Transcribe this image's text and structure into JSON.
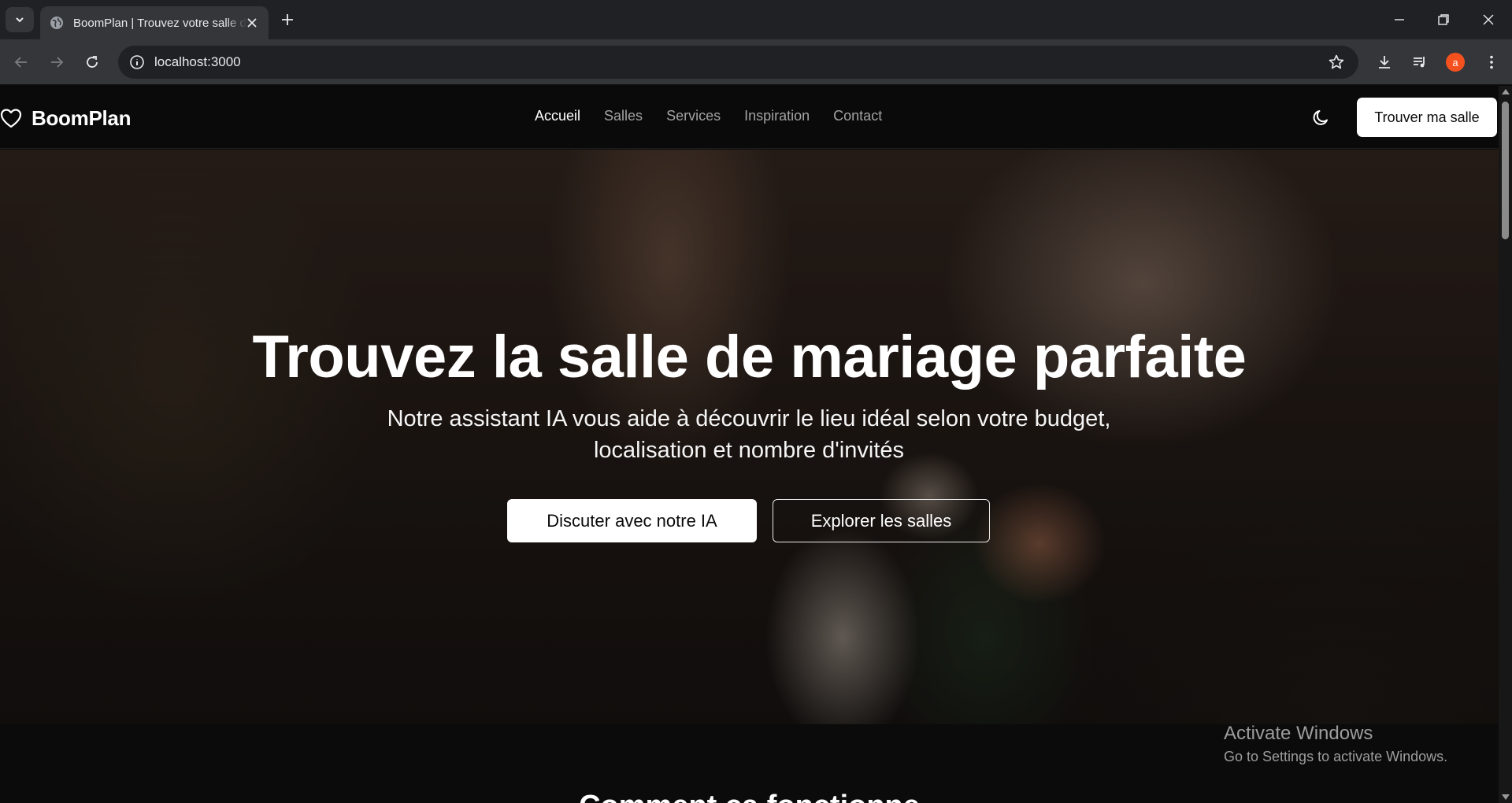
{
  "browser": {
    "tab_title": "BoomPlan | Trouvez votre salle de mariage",
    "url": "localhost:3000",
    "profile_initial": "a",
    "accent": "#f4511e",
    "icons": [
      "tab-search-icon",
      "globe-icon",
      "close-icon",
      "plus-icon",
      "minimize-icon",
      "restore-icon",
      "close-window-icon",
      "back-icon",
      "forward-icon",
      "reload-icon",
      "info-icon",
      "star-icon",
      "download-icon",
      "media-icon",
      "kebab-menu-icon"
    ]
  },
  "nav": {
    "brand": "BoomPlan",
    "links": [
      "Accueil",
      "Salles",
      "Services",
      "Inspiration",
      "Contact"
    ],
    "active": "Accueil",
    "cta": "Trouver ma salle"
  },
  "hero": {
    "title": "Trouvez la salle de mariage parfaite",
    "subtitle": "Notre assistant IA vous aide à découvrir le lieu idéal selon votre budget, localisation et nombre d'invités",
    "primary_button": "Discuter avec notre IA",
    "secondary_button": "Explorer les salles"
  },
  "next_section": {
    "title": "Comment ça fonctionne"
  },
  "watermark": {
    "title": "Activate Windows",
    "subtitle": "Go to Settings to activate Windows."
  }
}
